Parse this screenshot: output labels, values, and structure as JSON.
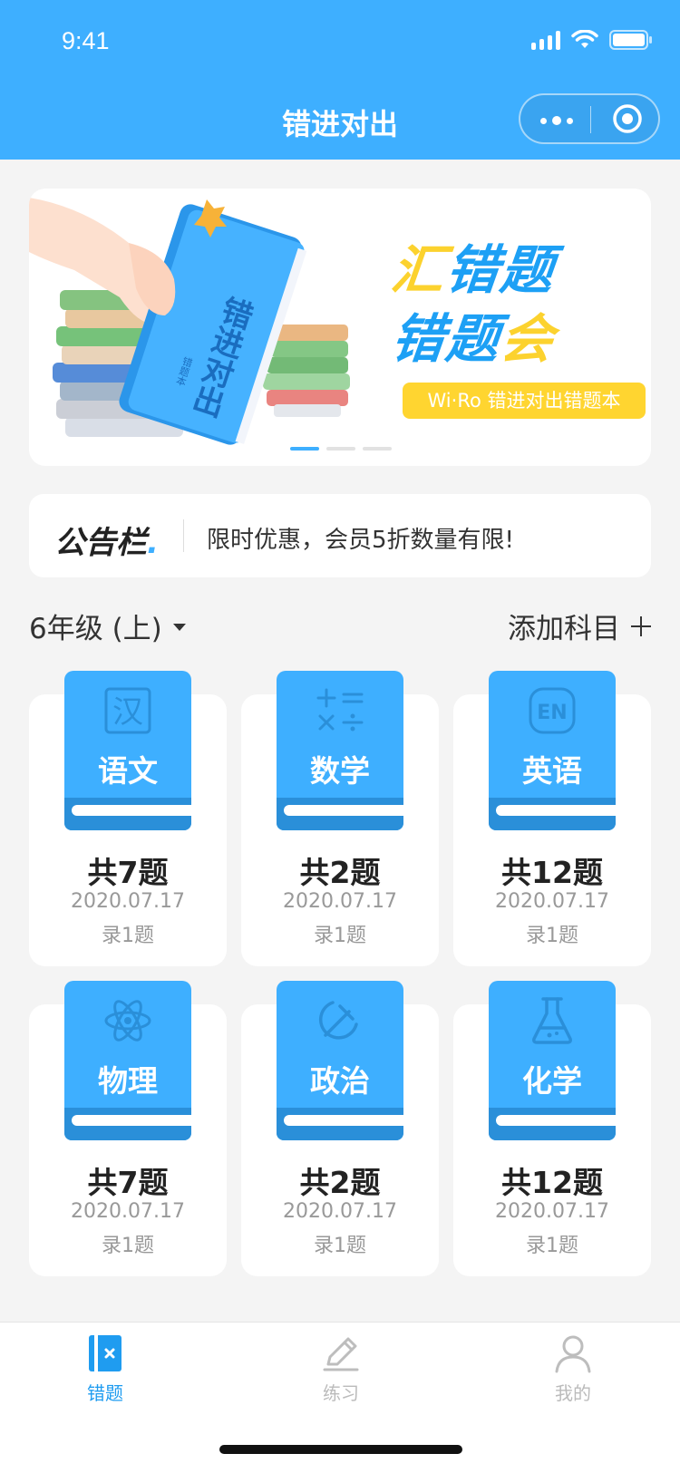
{
  "status_bar": {
    "time": "9:41"
  },
  "nav": {
    "title": "错进对出"
  },
  "banner": {
    "line1_a": "汇",
    "line1_b": "错题",
    "line2_a": "错题",
    "line2_b": "会",
    "book_title": "错进对出",
    "book_sub": "错题本",
    "tag": "Wi·Ro 错进对出错题本",
    "colors": {
      "blue": "#1da0f5",
      "yellow": "#fcd22e"
    }
  },
  "notice": {
    "logo": "公告栏",
    "text": "限时优惠，会员5折数量有限!"
  },
  "grade": {
    "label": "6年级 (上)"
  },
  "add_subject": {
    "label": "添加科目"
  },
  "subjects": [
    {
      "name": "语文",
      "icon": "chinese-character-icon",
      "icon_text": "汉",
      "count": "共7题",
      "date": "2020.07.17",
      "recorded": "录1题"
    },
    {
      "name": "数学",
      "icon": "math-operators-icon",
      "count": "共2题",
      "date": "2020.07.17",
      "recorded": "录1题"
    },
    {
      "name": "英语",
      "icon": "english-en-icon",
      "icon_text": "EN",
      "count": "共12题",
      "date": "2020.07.17",
      "recorded": "录1题"
    },
    {
      "name": "物理",
      "icon": "atom-icon",
      "count": "共7题",
      "date": "2020.07.17",
      "recorded": "录1题"
    },
    {
      "name": "政治",
      "icon": "hammer-sickle-icon",
      "count": "共2题",
      "date": "2020.07.17",
      "recorded": "录1题"
    },
    {
      "name": "化学",
      "icon": "flask-icon",
      "count": "共12题",
      "date": "2020.07.17",
      "recorded": "录1题"
    }
  ],
  "tabbar": {
    "items": [
      {
        "label": "错题",
        "icon": "wrong-book-icon",
        "active": true
      },
      {
        "label": "练习",
        "icon": "pencil-icon",
        "active": false
      },
      {
        "label": "我的",
        "icon": "user-icon",
        "active": false
      }
    ]
  },
  "theme": {
    "primary": "#3eafff",
    "primary_dark": "#2a8fd9",
    "background": "#f4f4f4"
  }
}
